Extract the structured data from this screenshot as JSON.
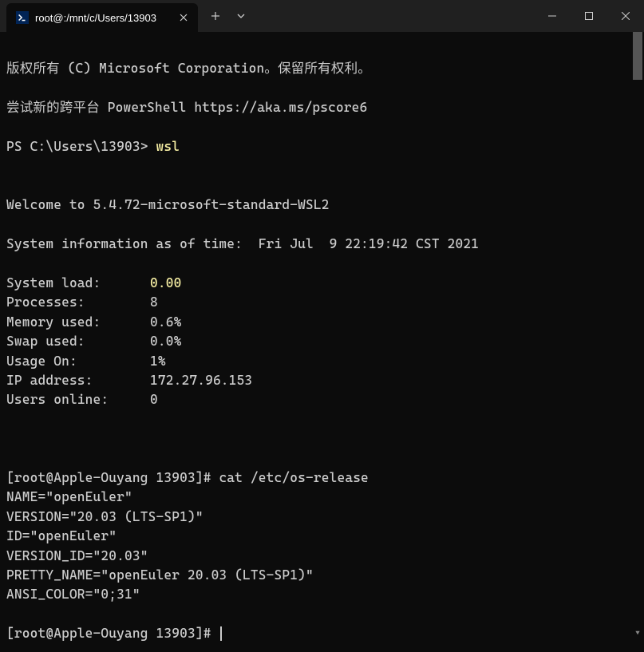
{
  "titlebar": {
    "tab_title": "root@:/mnt/c/Users/13903",
    "tab_icon_glyph": ">_"
  },
  "terminal": {
    "copyright": "版权所有 (C) Microsoft Corporation。保留所有权利。",
    "pscore_line": "尝试新的跨平台 PowerShell https://aka.ms/pscore6",
    "ps_prompt": "PS C:\\Users\\13903> ",
    "ps_command": "wsl",
    "welcome": "Welcome to 5.4.72-microsoft-standard-WSL2",
    "sysinfo_header": "System information as of time:  Fri Jul  9 22:19:42 CST 2021",
    "stats": {
      "system_load": {
        "label": "System load:",
        "value": "0.00"
      },
      "processes": {
        "label": "Processes:",
        "value": "8"
      },
      "memory_used": {
        "label": "Memory used:",
        "value": "0.6%"
      },
      "swap_used": {
        "label": "Swap used:",
        "value": "0.0%"
      },
      "usage_on": {
        "label": "Usage On:",
        "value": "1%"
      },
      "ip_address": {
        "label": "IP address:",
        "value": "172.27.96.153"
      },
      "users_online": {
        "label": "Users online:",
        "value": "0"
      }
    },
    "prompt1": "[root@Apple-Ouyang 13903]# ",
    "cmd1": "cat /etc/os-release",
    "os_release": [
      "NAME=\"openEuler\"",
      "VERSION=\"20.03 (LTS-SP1)\"",
      "ID=\"openEuler\"",
      "VERSION_ID=\"20.03\"",
      "PRETTY_NAME=\"openEuler 20.03 (LTS-SP1)\"",
      "ANSI_COLOR=\"0;31\""
    ],
    "prompt2": "[root@Apple-Ouyang 13903]# "
  }
}
